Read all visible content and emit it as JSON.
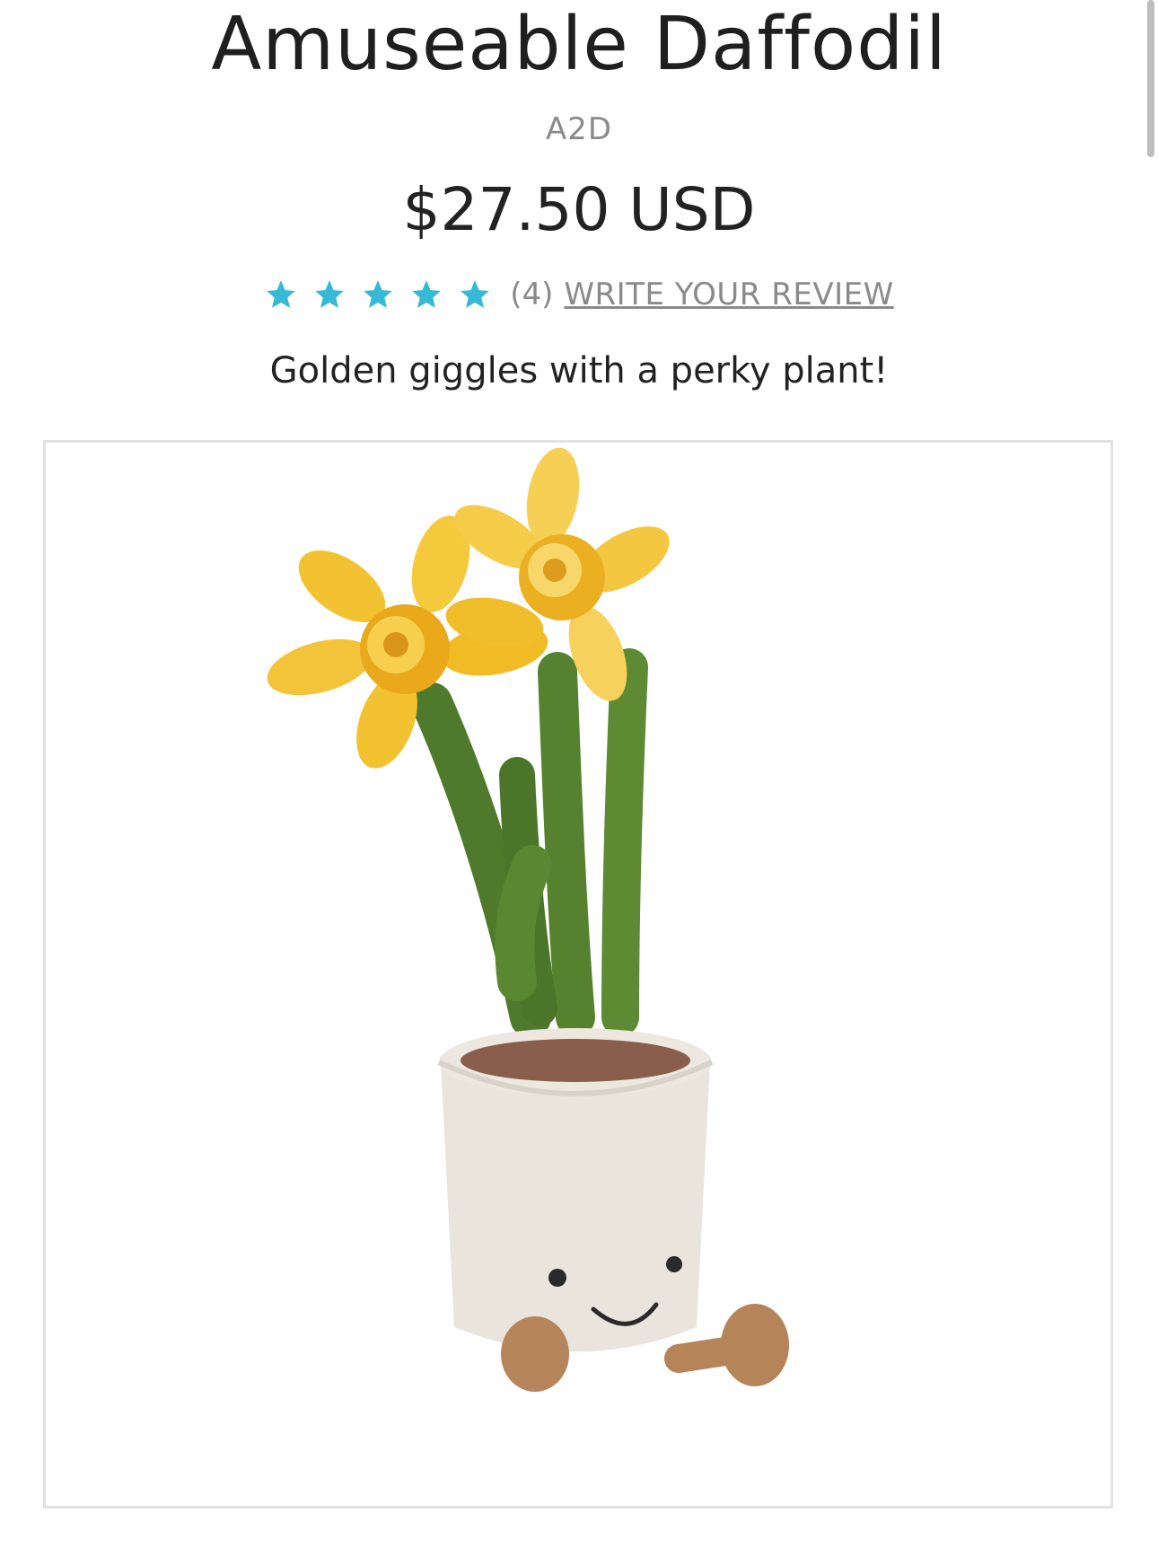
{
  "product": {
    "title": "Amuseable Daffodil",
    "sku": "A2D",
    "price": "$27.50 USD",
    "tagline": "Golden giggles with a perky plant!"
  },
  "rating": {
    "stars": 5,
    "count_label": "(4)",
    "write_review_label": "WRITE YOUR REVIEW",
    "star_color": "#35b9d6"
  },
  "image": {
    "subject": "daffodil-plush-in-pot"
  }
}
